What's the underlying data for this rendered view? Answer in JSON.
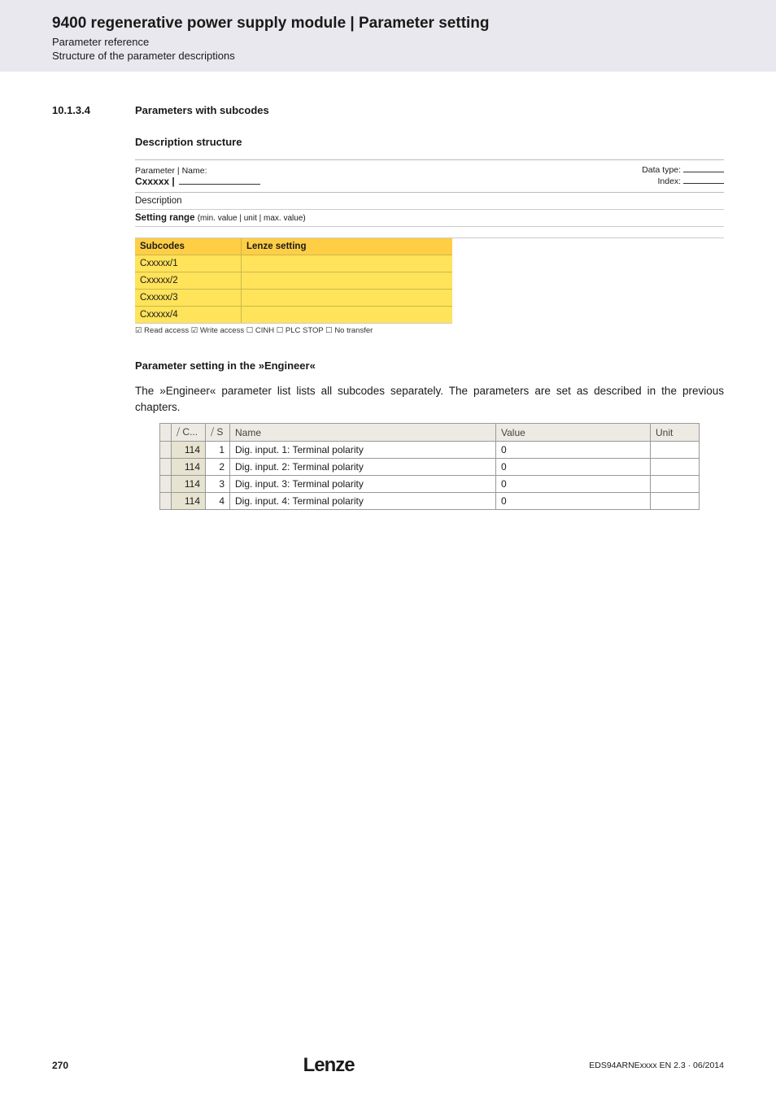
{
  "header": {
    "title": "9400 regenerative power supply module | Parameter setting",
    "sub1": "Parameter reference",
    "sub2": "Structure of the parameter descriptions"
  },
  "section": {
    "number": "10.1.3.4",
    "title": "Parameters with subcodes"
  },
  "block1": {
    "heading": "Description structure",
    "paramLabel": "Parameter | Name:",
    "paramCode": "Cxxxxx |",
    "dataTypeLabel": "Data type:",
    "indexLabel": "Index:",
    "descriptionRow": "Description",
    "settingRangeLabel": "Setting range",
    "settingRangeDetail": "(min. value | unit | max. value)",
    "subcodesHdr": "Subcodes",
    "lenzeHdr": "Lenze setting",
    "rows": [
      "Cxxxxx/1",
      "Cxxxxx/2",
      "Cxxxxx/3",
      "Cxxxxx/4"
    ],
    "flags": "☑ Read access   ☑ Write access   ☐ CINH   ☐ PLC STOP   ☐ No transfer"
  },
  "block2": {
    "heading": "Parameter setting in the »Engineer«",
    "paragraph": "The »Engineer« parameter list lists all subcodes separately. The parameters are set as described in the previous chapters.",
    "cols": {
      "expand": "",
      "c": "⧸ C...",
      "s": "⧸ S",
      "name": "Name",
      "value": "Value",
      "unit": "Unit"
    },
    "rows": [
      {
        "c": "114",
        "s": "1",
        "name": "Dig. input. 1: Terminal polarity",
        "value": "0",
        "unit": ""
      },
      {
        "c": "114",
        "s": "2",
        "name": "Dig. input. 2: Terminal polarity",
        "value": "0",
        "unit": ""
      },
      {
        "c": "114",
        "s": "3",
        "name": "Dig. input. 3: Terminal polarity",
        "value": "0",
        "unit": ""
      },
      {
        "c": "114",
        "s": "4",
        "name": "Dig. input. 4: Terminal polarity",
        "value": "0",
        "unit": ""
      }
    ]
  },
  "footer": {
    "page": "270",
    "logo": "Lenze",
    "docref": "EDS94ARNExxxx EN 2.3 · 06/2014"
  }
}
